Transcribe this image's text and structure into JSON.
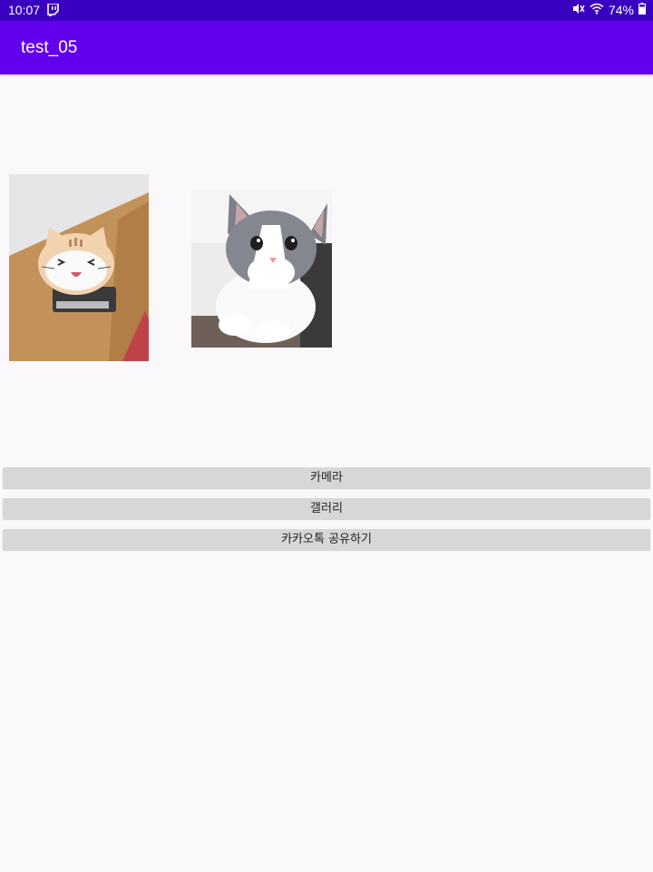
{
  "status_bar": {
    "time": "10:07",
    "battery_percent": "74%",
    "icons": [
      "twitch-icon",
      "mute-vibrate-icon",
      "wifi-icon",
      "battery-icon"
    ]
  },
  "app_bar": {
    "title": "test_05"
  },
  "images": [
    {
      "name": "plush-cat-photo"
    },
    {
      "name": "kitten-photo"
    }
  ],
  "buttons": {
    "camera": "카메라",
    "gallery": "갤러리",
    "kakao_share": "카카오톡 공유하기"
  },
  "colors": {
    "status_bar": "#3a00c2",
    "app_bar": "#6200ee",
    "background": "#fbf8fb",
    "button": "#d7d7d9"
  }
}
